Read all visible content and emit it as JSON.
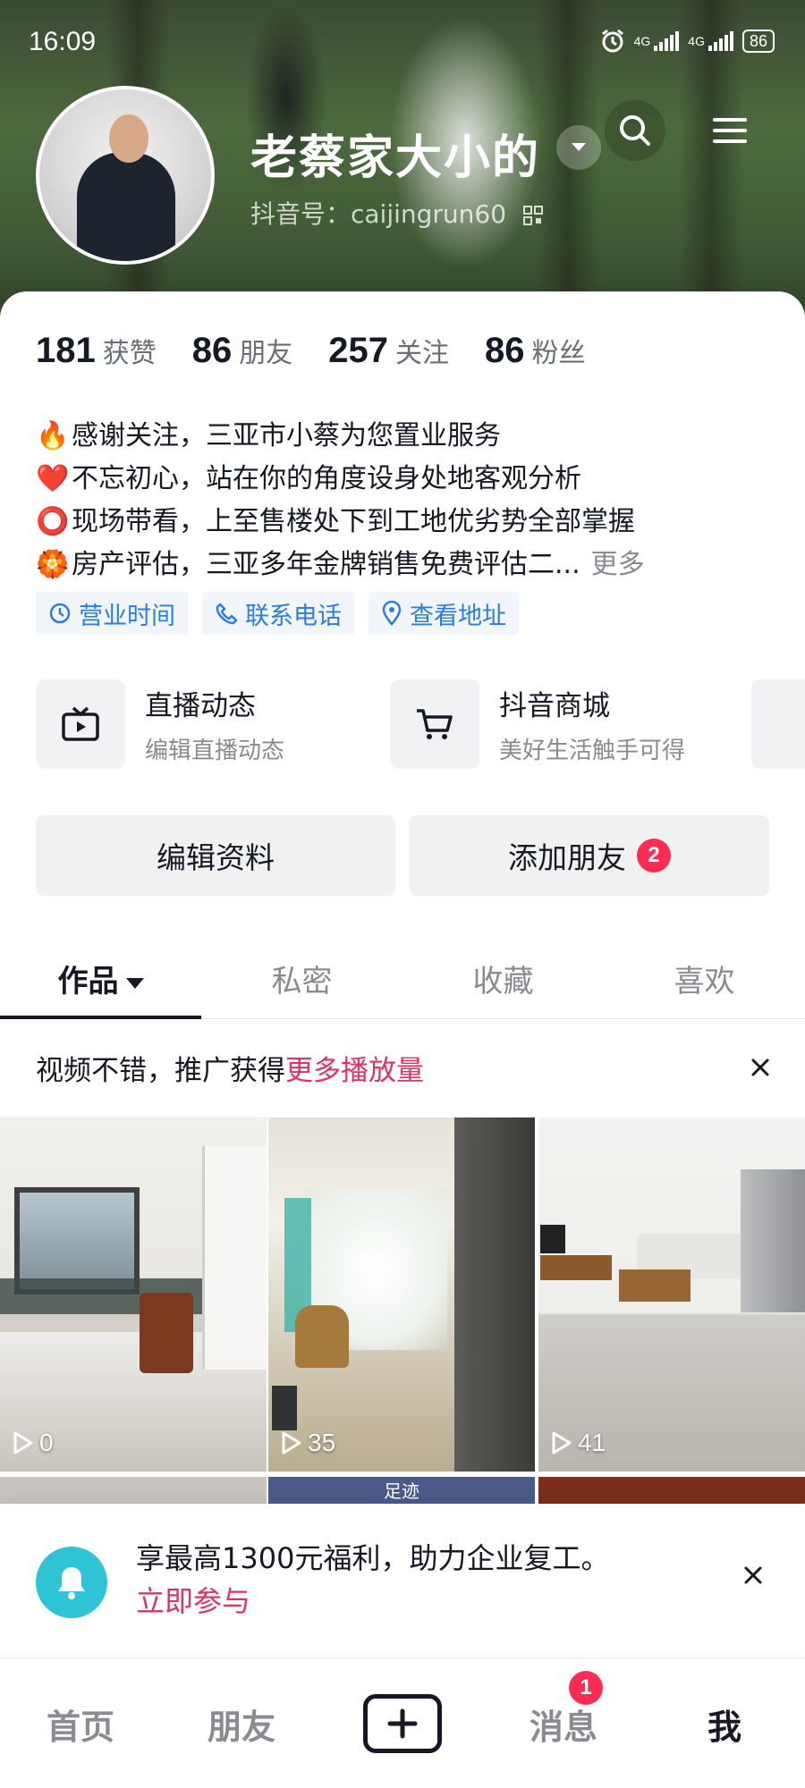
{
  "status_bar": {
    "time": "16:09",
    "network_1": "4G",
    "network_2": "4G",
    "battery": "86"
  },
  "profile": {
    "username": "老蔡家大小的",
    "douyin_id": "抖音号：caijingrun60"
  },
  "stats": [
    {
      "value": "181",
      "label": "获赞"
    },
    {
      "value": "86",
      "label": "朋友"
    },
    {
      "value": "257",
      "label": "关注"
    },
    {
      "value": "86",
      "label": "粉丝"
    }
  ],
  "bio": {
    "lines": [
      {
        "emoji": "🔥",
        "text": "感谢关注，三亚市小蔡为您置业服务"
      },
      {
        "emoji": "❤️",
        "text": "不忘初心，站在你的角度设身处地客观分析"
      },
      {
        "emoji": "⭕",
        "text": "现场带看，上至售楼处下到工地优劣势全部掌握"
      },
      {
        "emoji": "🏵️",
        "text": "房产评估，三亚多年金牌销售免费评估二..."
      }
    ],
    "more": "更多"
  },
  "chips": [
    {
      "label": "营业时间",
      "icon": "clock-icon"
    },
    {
      "label": "联系电话",
      "icon": "phone-icon"
    },
    {
      "label": "查看地址",
      "icon": "location-pin-icon"
    }
  ],
  "services": [
    {
      "title": "直播动态",
      "subtitle": "编辑直播动态",
      "icon": "tv-icon"
    },
    {
      "title": "抖音商城",
      "subtitle": "美好生活触手可得",
      "icon": "cart-icon"
    }
  ],
  "actions": {
    "edit_profile": "编辑资料",
    "add_friend": "添加朋友",
    "add_friend_badge": "2"
  },
  "tabs": [
    {
      "label": "作品",
      "active": true
    },
    {
      "label": "私密",
      "active": false
    },
    {
      "label": "收藏",
      "active": false
    },
    {
      "label": "喜欢",
      "active": false
    }
  ],
  "promo": {
    "prefix": "视频不错，推广获得",
    "highlight": "更多播放量"
  },
  "videos": [
    {
      "views": "0"
    },
    {
      "views": "35"
    },
    {
      "views": "41"
    }
  ],
  "row2_caption": "足迹",
  "notice": {
    "text": "享最高1300元福利，助力企业复工。",
    "cta": "立即参与"
  },
  "bottom_nav": {
    "home": "首页",
    "friends": "朋友",
    "messages": "消息",
    "messages_badge": "1",
    "me": "我"
  },
  "colors": {
    "accent": "#fe2c55",
    "link": "#2b7de0",
    "promo_highlight": "#e1315e",
    "bell": "#2ec4d6"
  }
}
